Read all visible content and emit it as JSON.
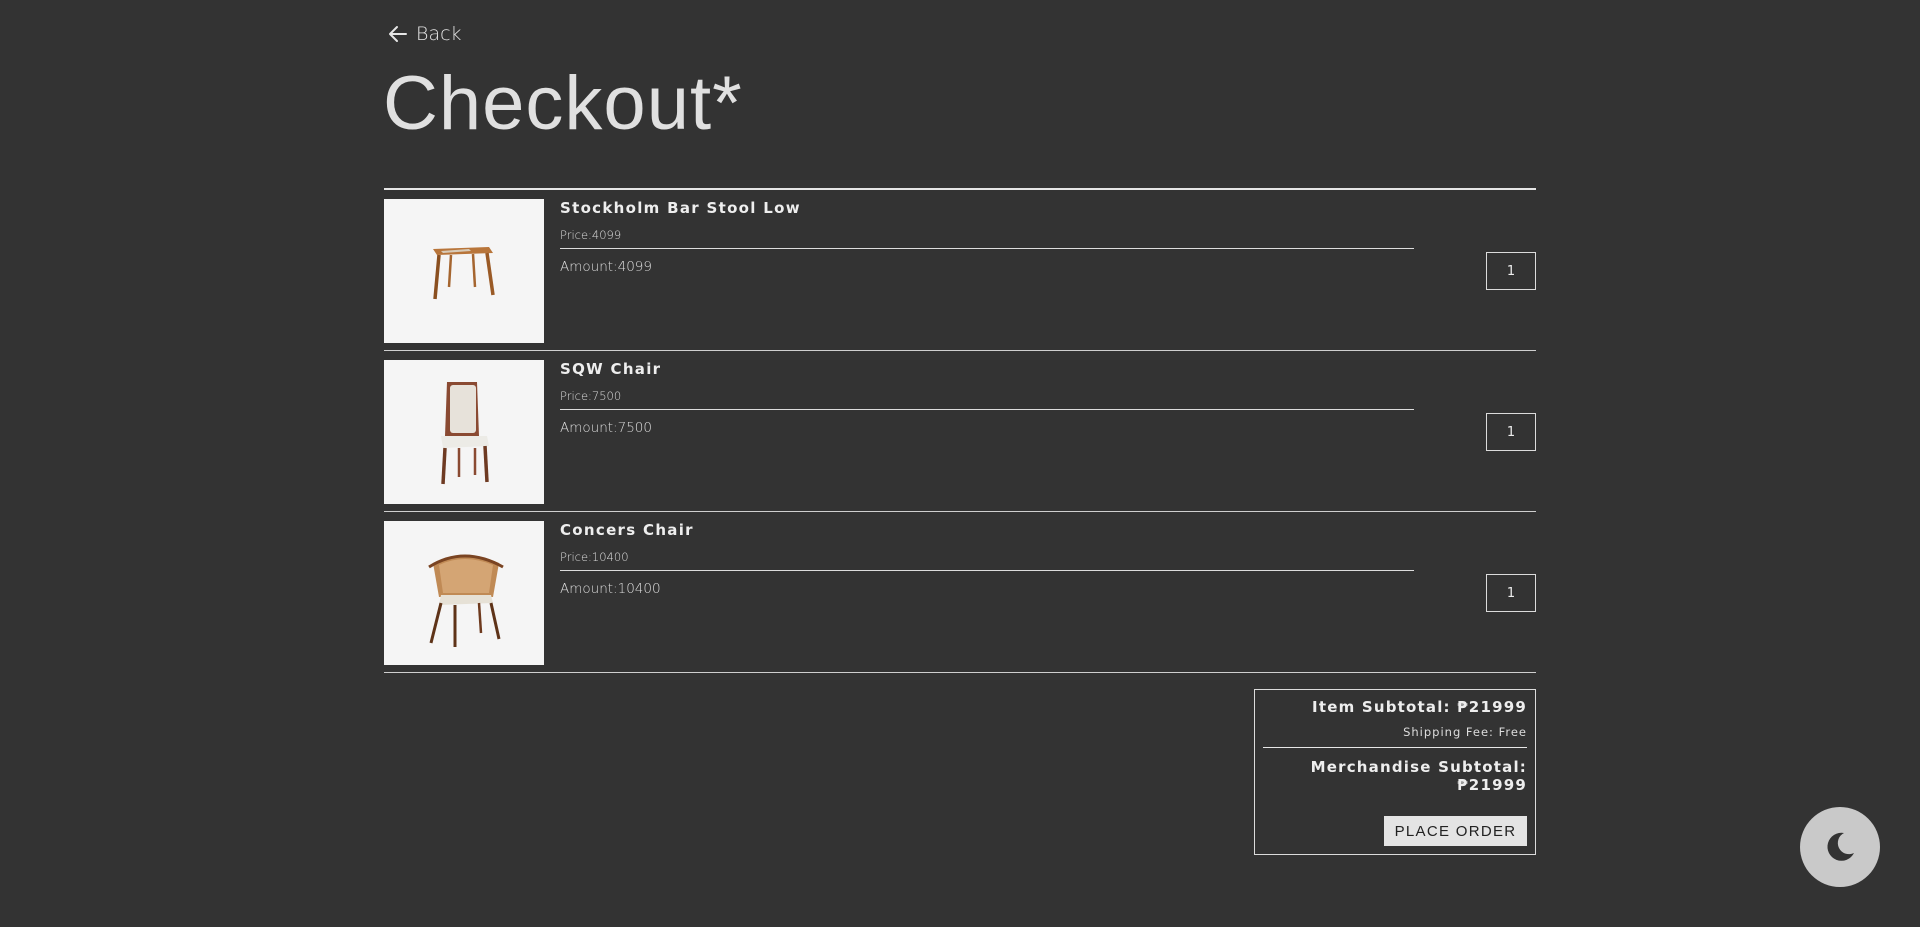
{
  "nav": {
    "back_label": "Back",
    "back_icon": "arrow-left-icon"
  },
  "page_title": "Checkout*",
  "items": [
    {
      "name": "Stockholm Bar Stool Low",
      "price": "Price:4099",
      "amount": "Amount:4099",
      "quantity": "1",
      "image": "bar-stool"
    },
    {
      "name": "SQW Chair",
      "price": "Price:7500",
      "amount": "Amount:7500",
      "quantity": "1",
      "image": "upholstered-chair"
    },
    {
      "name": "Concers Chair",
      "price": "Price:10400",
      "amount": "Amount:10400",
      "quantity": "1",
      "image": "rattan-armchair"
    }
  ],
  "summary": {
    "item_subtotal": "Item Subtotal: ₱21999",
    "shipping_fee": "Shipping Fee: Free",
    "merchandise_subtotal": "Merchandise Subtotal: ₱21999",
    "place_order_label": "PLACE ORDER"
  },
  "theme_toggle": {
    "icon": "moon-icon"
  },
  "colors": {
    "background": "#333333",
    "text": "#e6e6e6",
    "card": "#f5f5f5",
    "button": "#e4e4e4",
    "toggle": "#c9c9c9"
  }
}
